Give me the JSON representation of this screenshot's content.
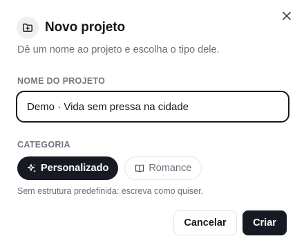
{
  "dialog": {
    "title": "Novo projeto",
    "subtitle": "Dê um nome ao projeto e escolha o tipo dele.",
    "header_icon": "folder-plus-icon",
    "close_icon": "close-icon"
  },
  "name_field": {
    "label": "NOME DO PROJETO",
    "value": "Demo · Vida sem pressa na cidade"
  },
  "category": {
    "label": "CATEGORIA",
    "options": [
      {
        "label": "Personalizado",
        "icon": "sparkles-icon",
        "selected": true
      },
      {
        "label": "Romance",
        "icon": "book-open-icon",
        "selected": false
      }
    ],
    "hint": "Sem estrutura predefinida: escreva como quiser."
  },
  "actions": {
    "cancel_label": "Cancelar",
    "create_label": "Criar"
  },
  "colors": {
    "primary": "#171a22",
    "muted_text": "#6b6f78",
    "border": "#e3e5e8"
  }
}
